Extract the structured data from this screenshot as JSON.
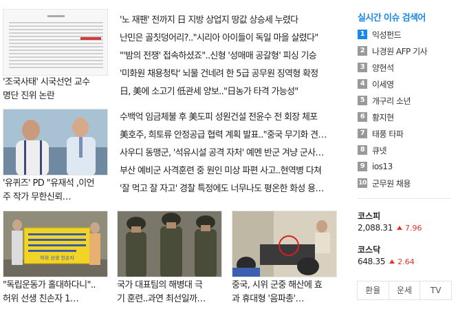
{
  "feature_cards": [
    {
      "line1": "'조국사태' 시국선언 교수",
      "line2": "명단 진위 논란"
    },
    {
      "line1": "'유퀴즈' PD \"유재석 ,이언",
      "line2": "주 작가 무한신뢰…"
    }
  ],
  "headline_groups": [
    [
      "'노 재팬' 전까지 日 지방 상업지 땅값 상승세 누렸다",
      "난민은 골칫덩어리?..\"시리아 아이들이 독일 마을 살렸다\"",
      "\"'밤의 전쟁' 접속하셨죠\"..신형 '성매매 공갈형' 피싱 기승",
      "'미화원 채용청탁' 뇌물 건네려 한 5급 공무원 징역형 확정",
      "日, 美에 소고기 低관세 양보..\"日농가 타격 가능성\""
    ],
    [
      "수백억 임금체불 후 美도피 성원건설 전윤수 전 회장 체포",
      "美호주, 희토류 안정공급 협력 계획 발표..\"중국 무기화 견…",
      "사우디 동맹군, '석유시설 공격 자처' 예멘 반군 겨냥 군사…",
      "부산 예비군 사격훈련 중 원인 미상 파편 사고..현역병 다쳐",
      "'잘 먹고 잘 자고' 경찰 특정에도 너무나도 평온한 화성 용…"
    ]
  ],
  "bottom_cards": [
    {
      "line1": "\"독립운동가 홀대하다니\"..",
      "line2": "허위 선생 친손자 1…",
      "sign_text": "허위 선생 친손자"
    },
    {
      "line1": "국가 대표팀의 해병대 극",
      "line2": "기 훈련..과연 최선일까…"
    },
    {
      "line1": "중국, 시위 군중 해산에 효",
      "line2": "과 휴대형 '음파총'…"
    }
  ],
  "realtime": {
    "title": "실시간 이슈 검색어",
    "items": [
      {
        "rank": "1",
        "label": "익성펀드"
      },
      {
        "rank": "2",
        "label": "나경원 AFP 기사"
      },
      {
        "rank": "3",
        "label": "양현석"
      },
      {
        "rank": "4",
        "label": "이세영"
      },
      {
        "rank": "5",
        "label": "개구리 소년"
      },
      {
        "rank": "6",
        "label": "황지현"
      },
      {
        "rank": "7",
        "label": "태풍 타파"
      },
      {
        "rank": "8",
        "label": "큐넷"
      },
      {
        "rank": "9",
        "label": "ios13"
      },
      {
        "rank": "10",
        "label": "군무원 채용"
      }
    ]
  },
  "indices": [
    {
      "name": "코스피",
      "value": "2,088.31",
      "change": "7.96",
      "direction": "up"
    },
    {
      "name": "코스닥",
      "value": "648.35",
      "change": "2.64",
      "direction": "up"
    }
  ],
  "tools": {
    "exchange": "환율",
    "fortune": "운세",
    "tv": "TV"
  },
  "colors": {
    "accent": "#1a88e8",
    "rise": "#e0322a",
    "rank_default": "#999999"
  }
}
